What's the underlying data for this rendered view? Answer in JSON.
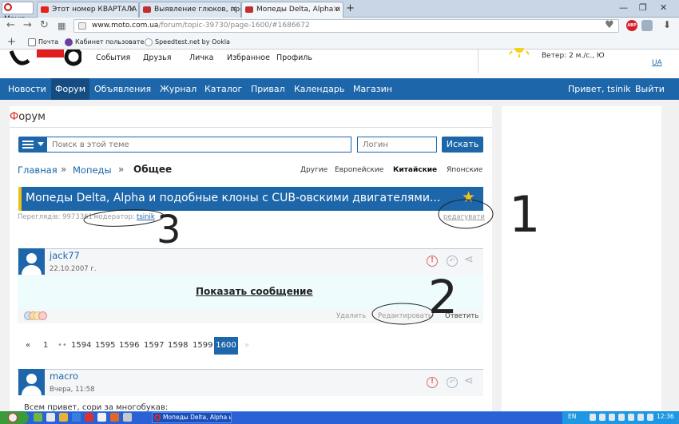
{
  "browser": {
    "menu_label": "Меню",
    "tabs": [
      {
        "title": "Этот номер КВАРТАЛА порв..."
      },
      {
        "title": "Выявление глюков, предло..."
      },
      {
        "title": "Мопеды Delta, Alpha и подоб..."
      }
    ],
    "url_host": "www.moto.com.ua",
    "url_path": "/forum/topic-39730/page-1600/#1686672",
    "bookmarks": [
      "Почта",
      "Кабинет пользовате...",
      "Speedtest.net by Ookla"
    ]
  },
  "site": {
    "top_links": [
      "События",
      "Друзья",
      "Личка",
      "Избранное",
      "Профиль"
    ],
    "weather": "Ветер: 2 м./с., Ю",
    "lang": "UA",
    "nav": [
      "Новости",
      "Форум",
      "Объявления",
      "Журнал",
      "Каталог",
      "Привал",
      "Календарь",
      "Магазин"
    ],
    "greeting": "Привет, tsinik",
    "logout": "Выйти"
  },
  "forum": {
    "title_first": "Ф",
    "title_rest": "орум",
    "search_placeholder": "Поиск в этой теме",
    "login_placeholder": "Логин",
    "search_button": "Искать",
    "breadcrumbs": [
      "Главная",
      "Мопеды"
    ],
    "crumb_sep": "»",
    "current": "Общее",
    "subcategories": [
      "Другие",
      "Европейские",
      "Китайские",
      "Японские"
    ]
  },
  "topic": {
    "title": "Мопеды Delta, Alpha и подобные клоны с CUB-овскими двигателями...",
    "views_label": "Переглядів: 9973361",
    "moderator_label": "модератор:",
    "moderator": "tsinik",
    "edit": "редагувати"
  },
  "posts": [
    {
      "author": "jack77",
      "date": "22.10.2007 г."
    },
    {
      "author": "macro",
      "date": "Вчера, 11:58",
      "text": "Всем привет, сори за многобукав:"
    }
  ],
  "post_actions": {
    "show_message": "Показать сообщение",
    "delete": "Удалить",
    "edit": "Редактировать",
    "reply": "Ответить"
  },
  "pagination": {
    "prev": "«",
    "first": "1",
    "ellipsis": "••",
    "pages": [
      "1594",
      "1595",
      "1596",
      "1597",
      "1598",
      "1599"
    ],
    "current": "1600",
    "next": "»"
  },
  "annotations": [
    "1",
    "2",
    "3"
  ],
  "taskbar": {
    "task_title": "Мопеды Delta, Alpha и...",
    "lang": "EN",
    "clock": "12:36"
  },
  "colors": {
    "primary": "#1d66a9",
    "primary_dark": "#154d82",
    "accent_red": "#d42a2a",
    "star": "#f3c21b"
  }
}
